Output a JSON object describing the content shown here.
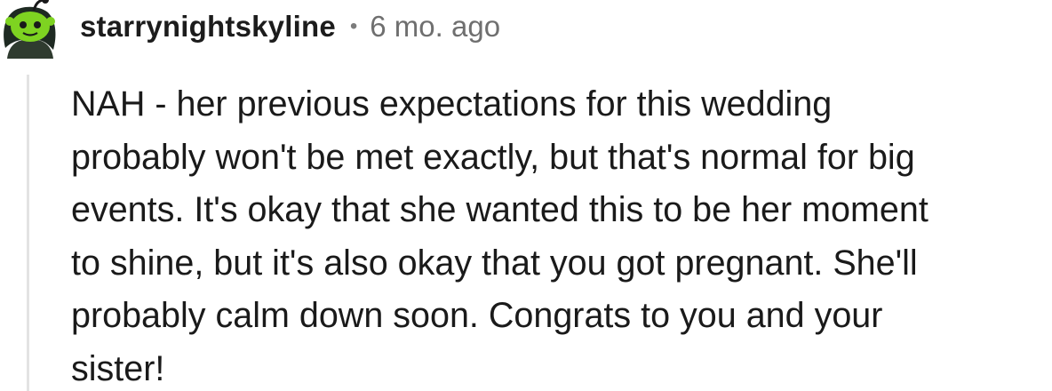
{
  "comment": {
    "username": "starrynightskyline",
    "separator": "•",
    "timestamp": "6 mo. ago",
    "body_lines": [
      "NAH - her previous expectations for this wedding",
      "probably won't be met exactly, but that's normal for big",
      "events. It's okay that she wanted this to be her moment",
      "to shine, but it's also okay that you got pregnant. She'll",
      "probably calm down soon. Congrats to you and your",
      "sister!"
    ]
  },
  "colors": {
    "avatar_green": "#7ed321",
    "username": "#1c1c1c",
    "timestamp": "#6f6f6f",
    "thread_line": "#e3e3e3"
  }
}
